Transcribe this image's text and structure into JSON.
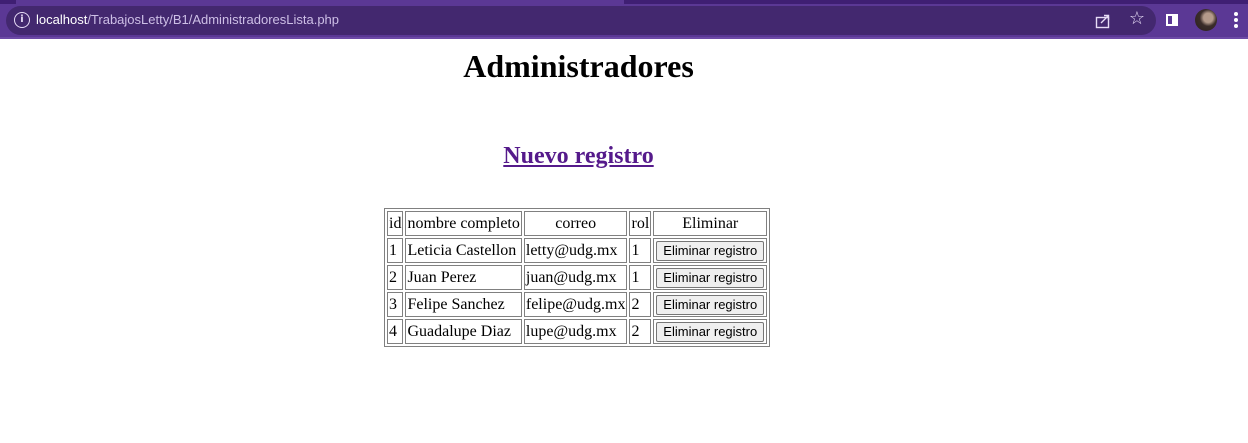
{
  "browser": {
    "url_host": "localhost",
    "url_path": "/TrabajosLetty/B1/AdministradoresLista.php"
  },
  "page": {
    "title": "Administradores",
    "new_link": "Nuevo registro"
  },
  "table": {
    "headers": [
      "id",
      "nombre completo",
      "correo",
      "rol",
      "Eliminar"
    ],
    "rows": [
      {
        "id": "1",
        "nombre": "Leticia Castellon",
        "correo": "letty@udg.mx",
        "rol": "1",
        "action": "Eliminar registro"
      },
      {
        "id": "2",
        "nombre": "Juan Perez",
        "correo": "juan@udg.mx",
        "rol": "1",
        "action": "Eliminar registro"
      },
      {
        "id": "3",
        "nombre": "Felipe Sanchez",
        "correo": "felipe@udg.mx",
        "rol": "2",
        "action": "Eliminar registro"
      },
      {
        "id": "4",
        "nombre": "Guadalupe Diaz",
        "correo": "lupe@udg.mx",
        "rol": "2",
        "action": "Eliminar registro"
      }
    ]
  }
}
